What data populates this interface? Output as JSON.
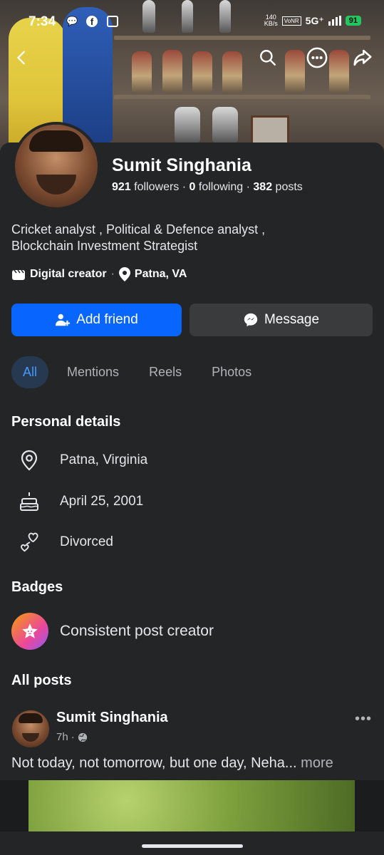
{
  "status": {
    "time": "7:34",
    "speed": "140",
    "speed_unit": "KB/s",
    "volte": "VoNR",
    "network": "5G⁺",
    "battery": "91"
  },
  "profile": {
    "name": "Sumit Singhania",
    "followers_count": "921",
    "followers_label": "followers",
    "following_count": "0",
    "following_label": "following",
    "posts_count": "382",
    "posts_label": "posts",
    "bio_line1": "Cricket analyst , Political & Defence analyst ,",
    "bio_line2": "Blockchain Investment Strategist",
    "category": "Digital creator",
    "location_short": "Patna, VA"
  },
  "actions": {
    "add_friend": "Add friend",
    "message": "Message"
  },
  "tabs": [
    {
      "label": "All"
    },
    {
      "label": "Mentions"
    },
    {
      "label": "Reels"
    },
    {
      "label": "Photos"
    }
  ],
  "personal_details": {
    "title": "Personal details",
    "location": "Patna, Virginia",
    "birthday": "April 25, 2001",
    "relationship": "Divorced"
  },
  "badges": {
    "title": "Badges",
    "item": "Consistent post creator"
  },
  "posts": {
    "title": "All posts",
    "author": "Sumit Singhania",
    "time": "7h",
    "separator": "·",
    "text": "Not today, not tomorrow, but one day, Neha...",
    "more": "more"
  },
  "colors": {
    "accent": "#0866ff",
    "background": "#242526",
    "tab_active_bg": "#263951",
    "tab_active_text": "#4599ff"
  }
}
